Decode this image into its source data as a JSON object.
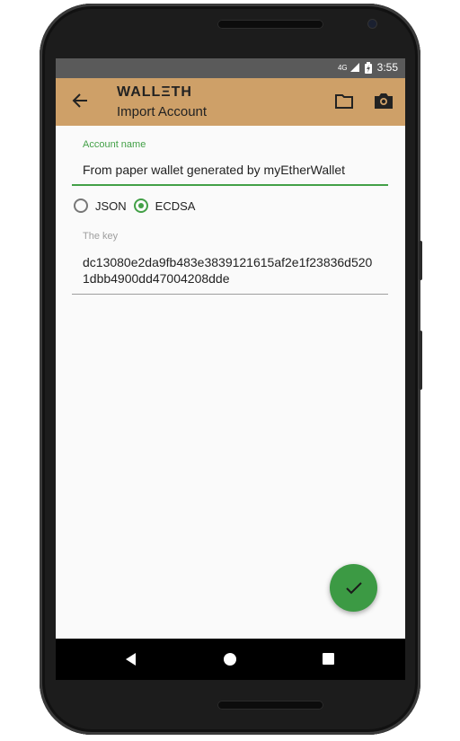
{
  "status_bar": {
    "network": "4G",
    "time": "3:55"
  },
  "app_bar": {
    "title": "WALLΞTH",
    "subtitle": "Import Account"
  },
  "form": {
    "account_name_label": "Account name",
    "account_name_value": "From paper wallet generated by myEtherWallet",
    "import_types": [
      {
        "label": "JSON",
        "selected": false
      },
      {
        "label": "ECDSA",
        "selected": true
      }
    ],
    "key_label": "The key",
    "key_value": "dc13080e2da9fb483e3839121615af2e1f23836d5201dbb4900dd47004208dde"
  },
  "colors": {
    "app_bar": "#cea068",
    "accent": "#43a047",
    "fab": "#3c9a44"
  },
  "icons": {
    "back": "arrow-left-icon",
    "folder": "folder-icon",
    "camera": "camera-icon",
    "fab": "check-icon"
  }
}
